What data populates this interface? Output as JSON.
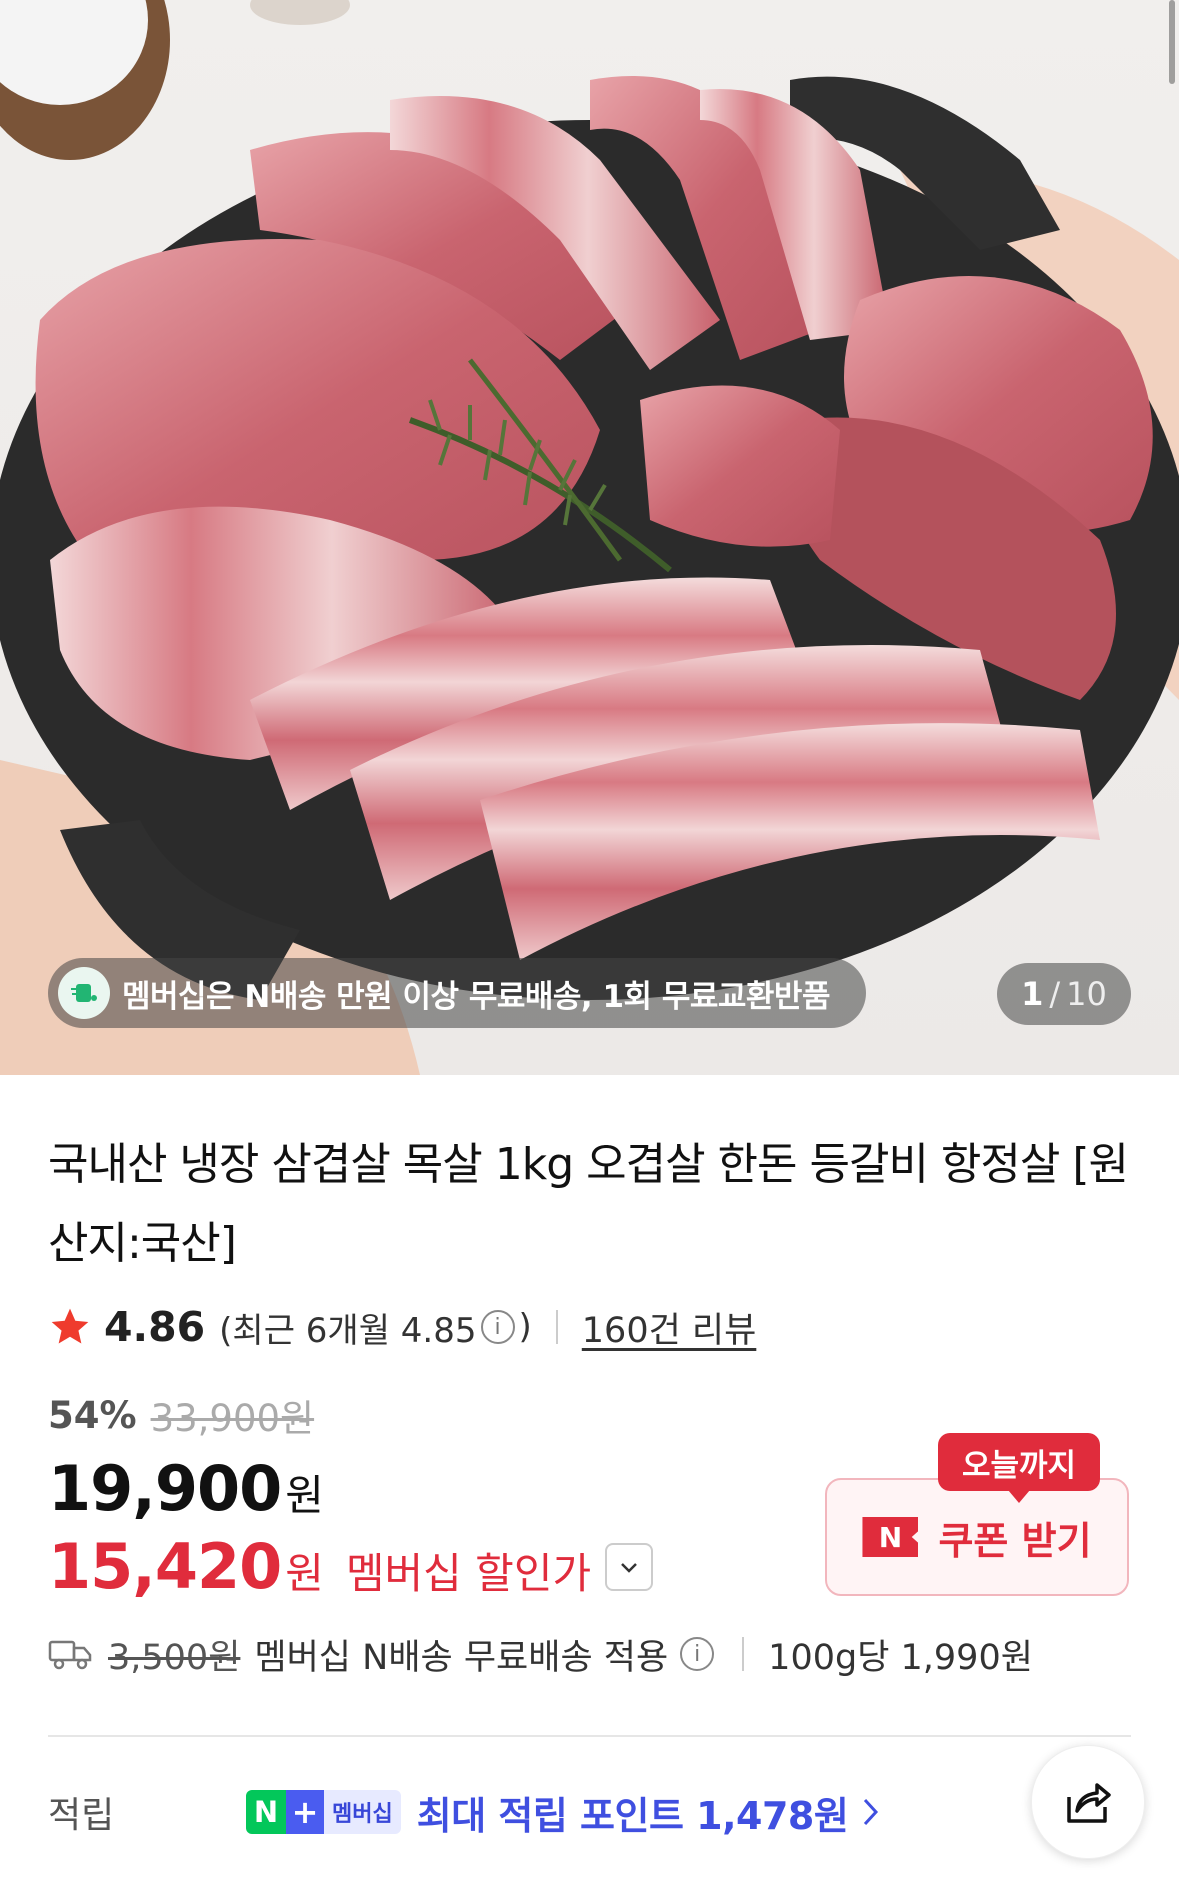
{
  "gallery": {
    "promo_text": "멤버십은 N배송 만원 이상 무료배송, 1회 무료교환반품",
    "current_index": "1",
    "separator": "/",
    "total": "10"
  },
  "product": {
    "title": "국내산 냉장 삼겹살 목살 1kg 오겹살 한돈 등갈비 항정살 [원산지:국산]"
  },
  "rating": {
    "score": "4.86",
    "recent_prefix": "(최근 6개월 4.85",
    "recent_suffix": ")",
    "info_glyph": "i",
    "review_link": "160건 리뷰"
  },
  "pricing": {
    "discount_percent": "54%",
    "original_price": "33,900원",
    "sale_price": "19,900",
    "currency": "원",
    "member_price": "15,420",
    "member_label": "멤버십 할인가"
  },
  "coupon": {
    "tag": "오늘까지",
    "n_mark": "N",
    "label": "쿠폰 받기"
  },
  "shipping": {
    "original_fee": "3,500원",
    "text": "멤버십 N배송 무료배송 적용",
    "info_glyph": "i",
    "unit_price": "100g당 1,990원"
  },
  "points": {
    "label": "적립",
    "badge_n": "N",
    "badge_plus": "+",
    "badge_membership": "멤버십",
    "text": "최대 적립 포인트 1,478원"
  },
  "colors": {
    "accent_red": "#e02c3c",
    "naver_green": "#03c75a",
    "membership_blue": "#3f4fe0"
  },
  "icons": [
    "delivery-icon",
    "star-icon",
    "info-icon",
    "chevron-down-icon",
    "truck-icon",
    "chevron-right-icon",
    "share-icon"
  ]
}
